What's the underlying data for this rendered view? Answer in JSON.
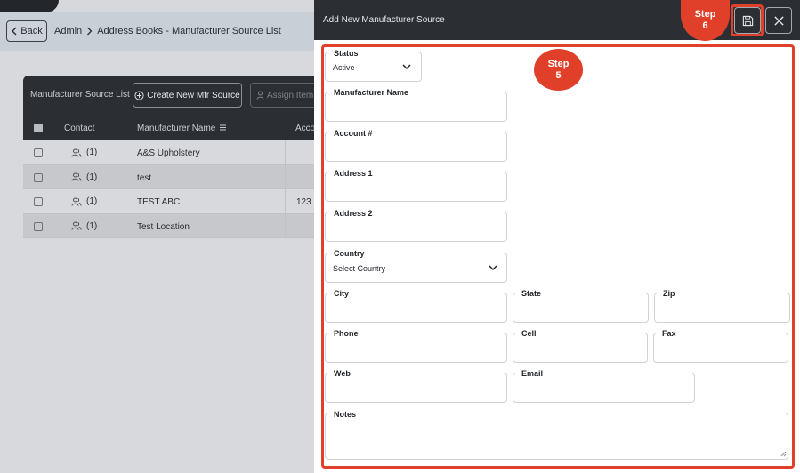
{
  "breadcrumb": {
    "back_label": "Back",
    "items": [
      "Admin",
      "Address Books - Manufacturer Source List"
    ]
  },
  "list": {
    "title": "Manufacturer Source List",
    "create_label": "Create New Mfr Source",
    "assign_label": "Assign Item",
    "columns": {
      "contact": "Contact",
      "manufacturer_name": "Manufacturer Name",
      "account": "Acco"
    },
    "rows": [
      {
        "contact": "(1)",
        "name": "A&S Upholstery",
        "account": ""
      },
      {
        "contact": "(1)",
        "name": "test",
        "account": ""
      },
      {
        "contact": "(1)",
        "name": "TEST ABC",
        "account": "123"
      },
      {
        "contact": "(1)",
        "name": "Test Location",
        "account": ""
      }
    ]
  },
  "modal": {
    "title": "Add New Manufacturer Source",
    "save_icon": "save-icon",
    "close_icon": "close-icon",
    "fields": {
      "status": {
        "label": "Status",
        "value": "Active"
      },
      "manufacturer_name": {
        "label": "Manufacturer Name",
        "value": ""
      },
      "account": {
        "label": "Account #",
        "value": ""
      },
      "address1": {
        "label": "Address 1",
        "value": ""
      },
      "address2": {
        "label": "Address 2",
        "value": ""
      },
      "country": {
        "label": "Country",
        "value": "Select Country"
      },
      "city": {
        "label": "City",
        "value": ""
      },
      "state": {
        "label": "State",
        "value": ""
      },
      "zip": {
        "label": "Zip",
        "value": ""
      },
      "phone": {
        "label": "Phone",
        "value": ""
      },
      "cell": {
        "label": "Cell",
        "value": ""
      },
      "fax": {
        "label": "Fax",
        "value": ""
      },
      "web": {
        "label": "Web",
        "value": ""
      },
      "email": {
        "label": "Email",
        "value": ""
      },
      "notes": {
        "label": "Notes",
        "value": ""
      }
    }
  },
  "annotations": {
    "step5": {
      "line1": "Step",
      "line2": "5"
    },
    "step6": {
      "line1": "Step",
      "line2": "6"
    }
  },
  "colors": {
    "annotation": "#e0402a",
    "dark_header": "#2b2f34",
    "overlay_bg": "#d7d9dc"
  }
}
